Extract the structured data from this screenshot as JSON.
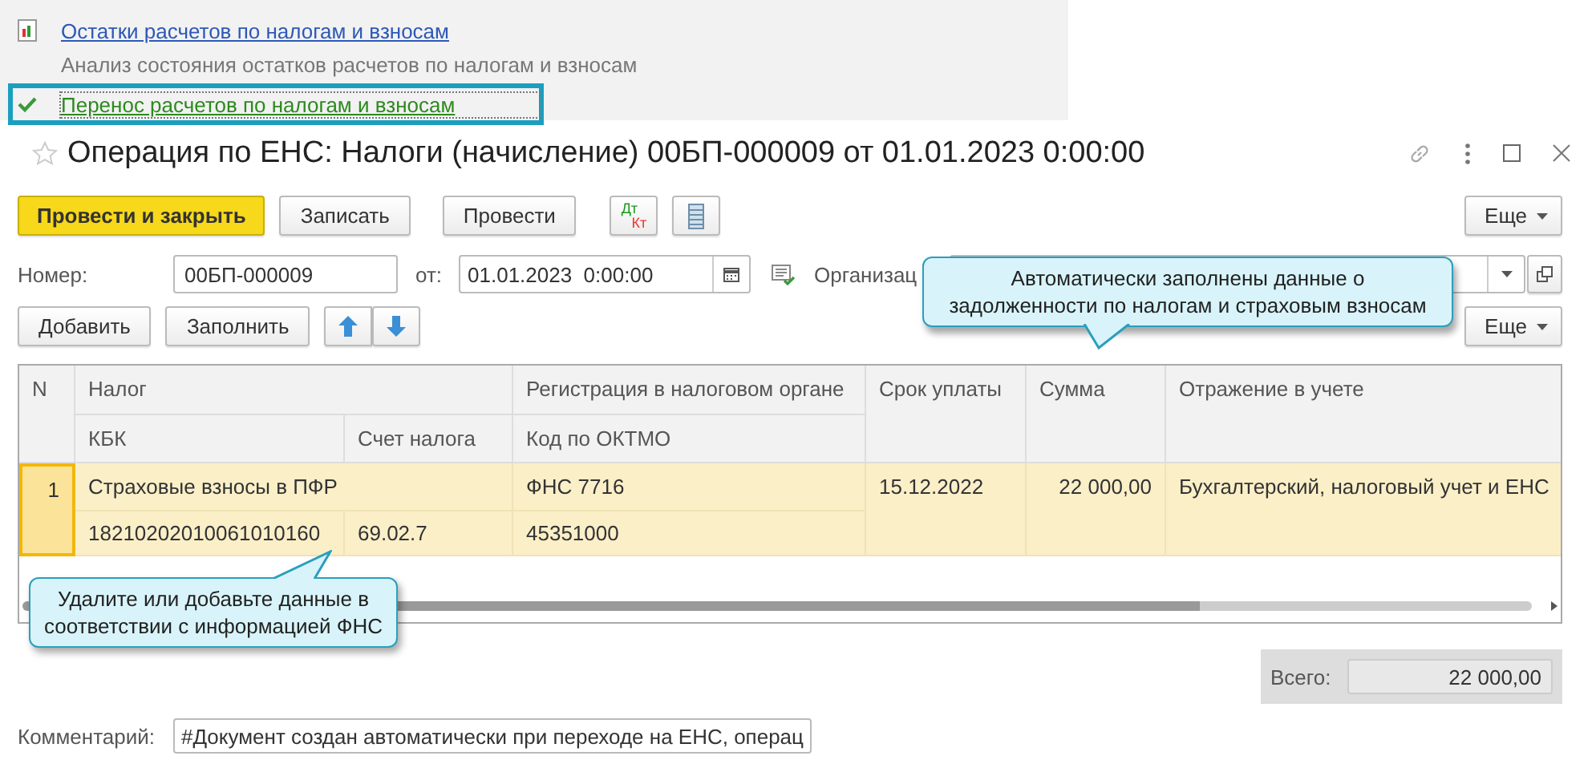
{
  "nav_panel": {
    "items": [
      {
        "kind": "report",
        "title": "Остатки расчетов по налогам и взносам",
        "description": "Анализ состояния остатков расчетов по налогам и взносам",
        "highlighted": false
      },
      {
        "kind": "done",
        "title": "Перенос расчетов по налогам и взносам",
        "highlighted": true
      }
    ]
  },
  "window": {
    "title": "Операция по ЕНС: Налоги (начисление) 00БП-000009 от 01.01.2023 0:00:00"
  },
  "toolbar": {
    "buttons": [
      {
        "kind": "default",
        "label": "Провести и закрыть"
      },
      {
        "kind": "normal",
        "label": "Записать"
      },
      {
        "kind": "normal",
        "label": "Провести"
      },
      {
        "kind": "dtkt",
        "label_top": "Дт",
        "label_bottom": "Кт"
      },
      {
        "kind": "list"
      }
    ],
    "more": "Еще"
  },
  "header": {
    "number_label": "Номер:",
    "number": "00БП-000009",
    "date_label": "от:",
    "date": "01.01.2023  0:00:00",
    "organization_label": "Организац"
  },
  "table_toolbar": {
    "buttons": [
      {
        "kind": "normal",
        "label": "Добавить"
      },
      {
        "kind": "normal",
        "label": "Заполнить"
      },
      {
        "kind": "up"
      },
      {
        "kind": "down"
      }
    ],
    "more": "Еще"
  },
  "table": {
    "columns": {
      "n": "N",
      "tax": "Налог",
      "kbk": "КБК",
      "account": "Счет налога",
      "registration": "Регистрация в налоговом органе",
      "oktmo": "Код по ОКТМО",
      "due": "Срок уплаты",
      "amount": "Сумма",
      "reflection": "Отражение в учете"
    },
    "rows": [
      {
        "n": "1",
        "tax": "Страховые взносы в ПФР",
        "kbk": "18210202010061010160",
        "account": "69.02.7",
        "registration": "ФНС 7716",
        "oktmo": "45351000",
        "due": "15.12.2022",
        "amount": "22 000,00",
        "reflection": "Бухгалтерский, налоговый учет и ЕНС",
        "selected": true
      }
    ]
  },
  "totals": {
    "label": "Всего:",
    "value": "22 000,00"
  },
  "comment": {
    "label": "Комментарий:",
    "value": "#Документ создан автоматически при переходе на ЕНС, операц"
  },
  "callouts": [
    {
      "kind": "pointer-down",
      "text": "Автоматически заполнены данные о задолженности по налогам и страховым взносам"
    },
    {
      "kind": "pointer-up",
      "text": "Удалите или добавьте данные в соответствии с информацией ФНС"
    }
  ]
}
